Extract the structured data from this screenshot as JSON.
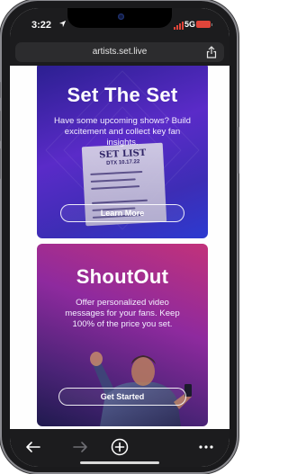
{
  "status_bar": {
    "time": "3:22",
    "network": "5G"
  },
  "browser": {
    "url": "artists.set.live"
  },
  "cards": [
    {
      "title": "Set The Set",
      "description": "Have some upcoming shows? Build excitement and collect key fan insights.",
      "button_label": "Learn More",
      "art": {
        "setlist_heading": "SET LIST",
        "setlist_date": "DTX 10.17.22"
      }
    },
    {
      "title": "ShoutOut",
      "description": "Offer personalized video messages for your fans. Keep 100% of the price you set.",
      "button_label": "Get Started"
    }
  ],
  "icons": {
    "location": "location-arrow-icon",
    "signal": "signal-bars-icon",
    "battery": "battery-icon",
    "share": "share-icon",
    "back": "back-arrow-icon",
    "forward": "forward-arrow-icon",
    "new_tab": "plus-icon",
    "more": "more-dots-icon"
  },
  "colors": {
    "chrome": "#1c1c1e",
    "battery": "#e0453a",
    "card1": "#5a2bc8",
    "card2": "#c2327a"
  }
}
